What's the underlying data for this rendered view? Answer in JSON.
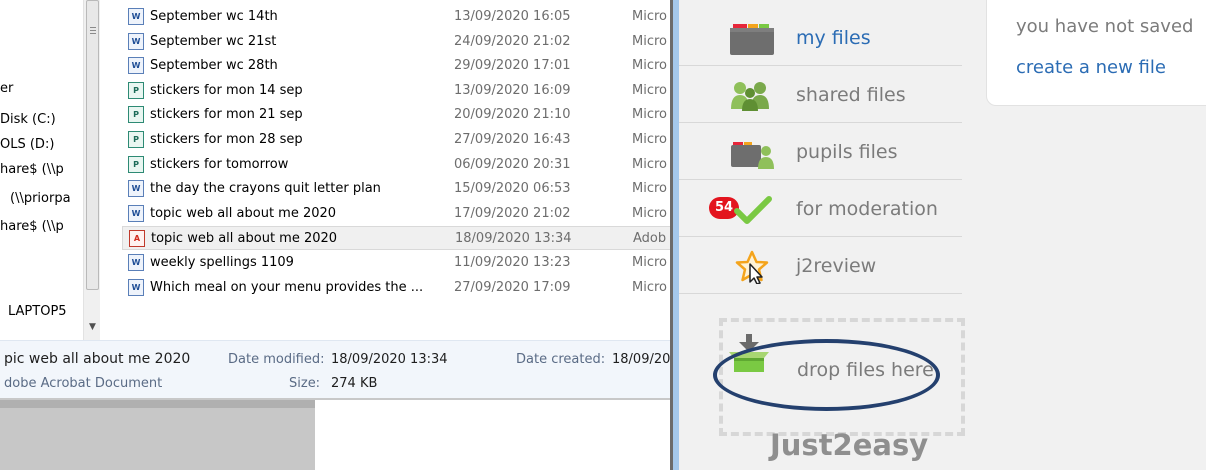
{
  "explorer": {
    "nav_items": [
      "er",
      "Disk (C:)",
      "OLS (D:)",
      "hare$ (\\\\p",
      "(\\\\priorpa",
      "hare$ (\\\\p",
      "LAPTOP5"
    ],
    "files": [
      {
        "name": "September wc 14th",
        "date": "13/09/2020 16:05",
        "type": "Micro",
        "icon": "word"
      },
      {
        "name": "September wc 21st",
        "date": "24/09/2020 21:02",
        "type": "Micro",
        "icon": "word"
      },
      {
        "name": "September wc 28th",
        "date": "29/09/2020 17:01",
        "type": "Micro",
        "icon": "word"
      },
      {
        "name": "stickers for mon 14 sep",
        "date": "13/09/2020 16:09",
        "type": "Micro",
        "icon": "publisher"
      },
      {
        "name": "stickers for mon 21 sep",
        "date": "20/09/2020 21:10",
        "type": "Micro",
        "icon": "publisher"
      },
      {
        "name": "stickers for mon 28 sep",
        "date": "27/09/2020 16:43",
        "type": "Micro",
        "icon": "publisher"
      },
      {
        "name": "stickers for tomorrow",
        "date": "06/09/2020 20:31",
        "type": "Micro",
        "icon": "publisher"
      },
      {
        "name": "the day the crayons quit letter plan",
        "date": "15/09/2020 06:53",
        "type": "Micro",
        "icon": "word"
      },
      {
        "name": "topic web all about me 2020",
        "date": "17/09/2020 21:02",
        "type": "Micro",
        "icon": "word"
      },
      {
        "name": "topic web all about me 2020",
        "date": "18/09/2020 13:34",
        "type": "Adob",
        "icon": "pdf",
        "selected": true
      },
      {
        "name": "weekly spellings 1109",
        "date": "11/09/2020 13:23",
        "type": "Micro",
        "icon": "word"
      },
      {
        "name": "Which meal on your menu provides the ...",
        "date": "27/09/2020 17:09",
        "type": "Micro",
        "icon": "word"
      }
    ],
    "icon_glyphs": {
      "word": "W",
      "publisher": "P",
      "pdf": "A"
    },
    "details": {
      "name": "pic web all about me 2020",
      "modified_label": "Date modified:",
      "modified_value": "18/09/2020 13:34",
      "created_label": "Date created:",
      "created_value": "18/09/20",
      "type_value": "dobe Acrobat Document",
      "size_label": "Size:",
      "size_value": "274 KB"
    }
  },
  "j2": {
    "menu": [
      {
        "label": "my files",
        "icon": "folder-icon",
        "link": true
      },
      {
        "label": "shared files",
        "icon": "people-icon",
        "link": false
      },
      {
        "label": "pupils files",
        "icon": "folder-person-icon",
        "link": false
      },
      {
        "label": "for moderation",
        "icon": "checkmark-icon",
        "badge": "54",
        "link": false
      },
      {
        "label": "j2review",
        "icon": "star-cursor-icon",
        "link": false
      }
    ],
    "drop_label": "drop files here",
    "logo": "Just2easy",
    "info_message": "you have not saved",
    "create_link": "create a new file"
  },
  "colors": {
    "link": "#2b6cb4",
    "muted": "#7b7b7b",
    "badge": "#e3141e",
    "ellipse": "#24406e",
    "check": "#7ac943",
    "pane_bg": "#f1f1f1"
  }
}
